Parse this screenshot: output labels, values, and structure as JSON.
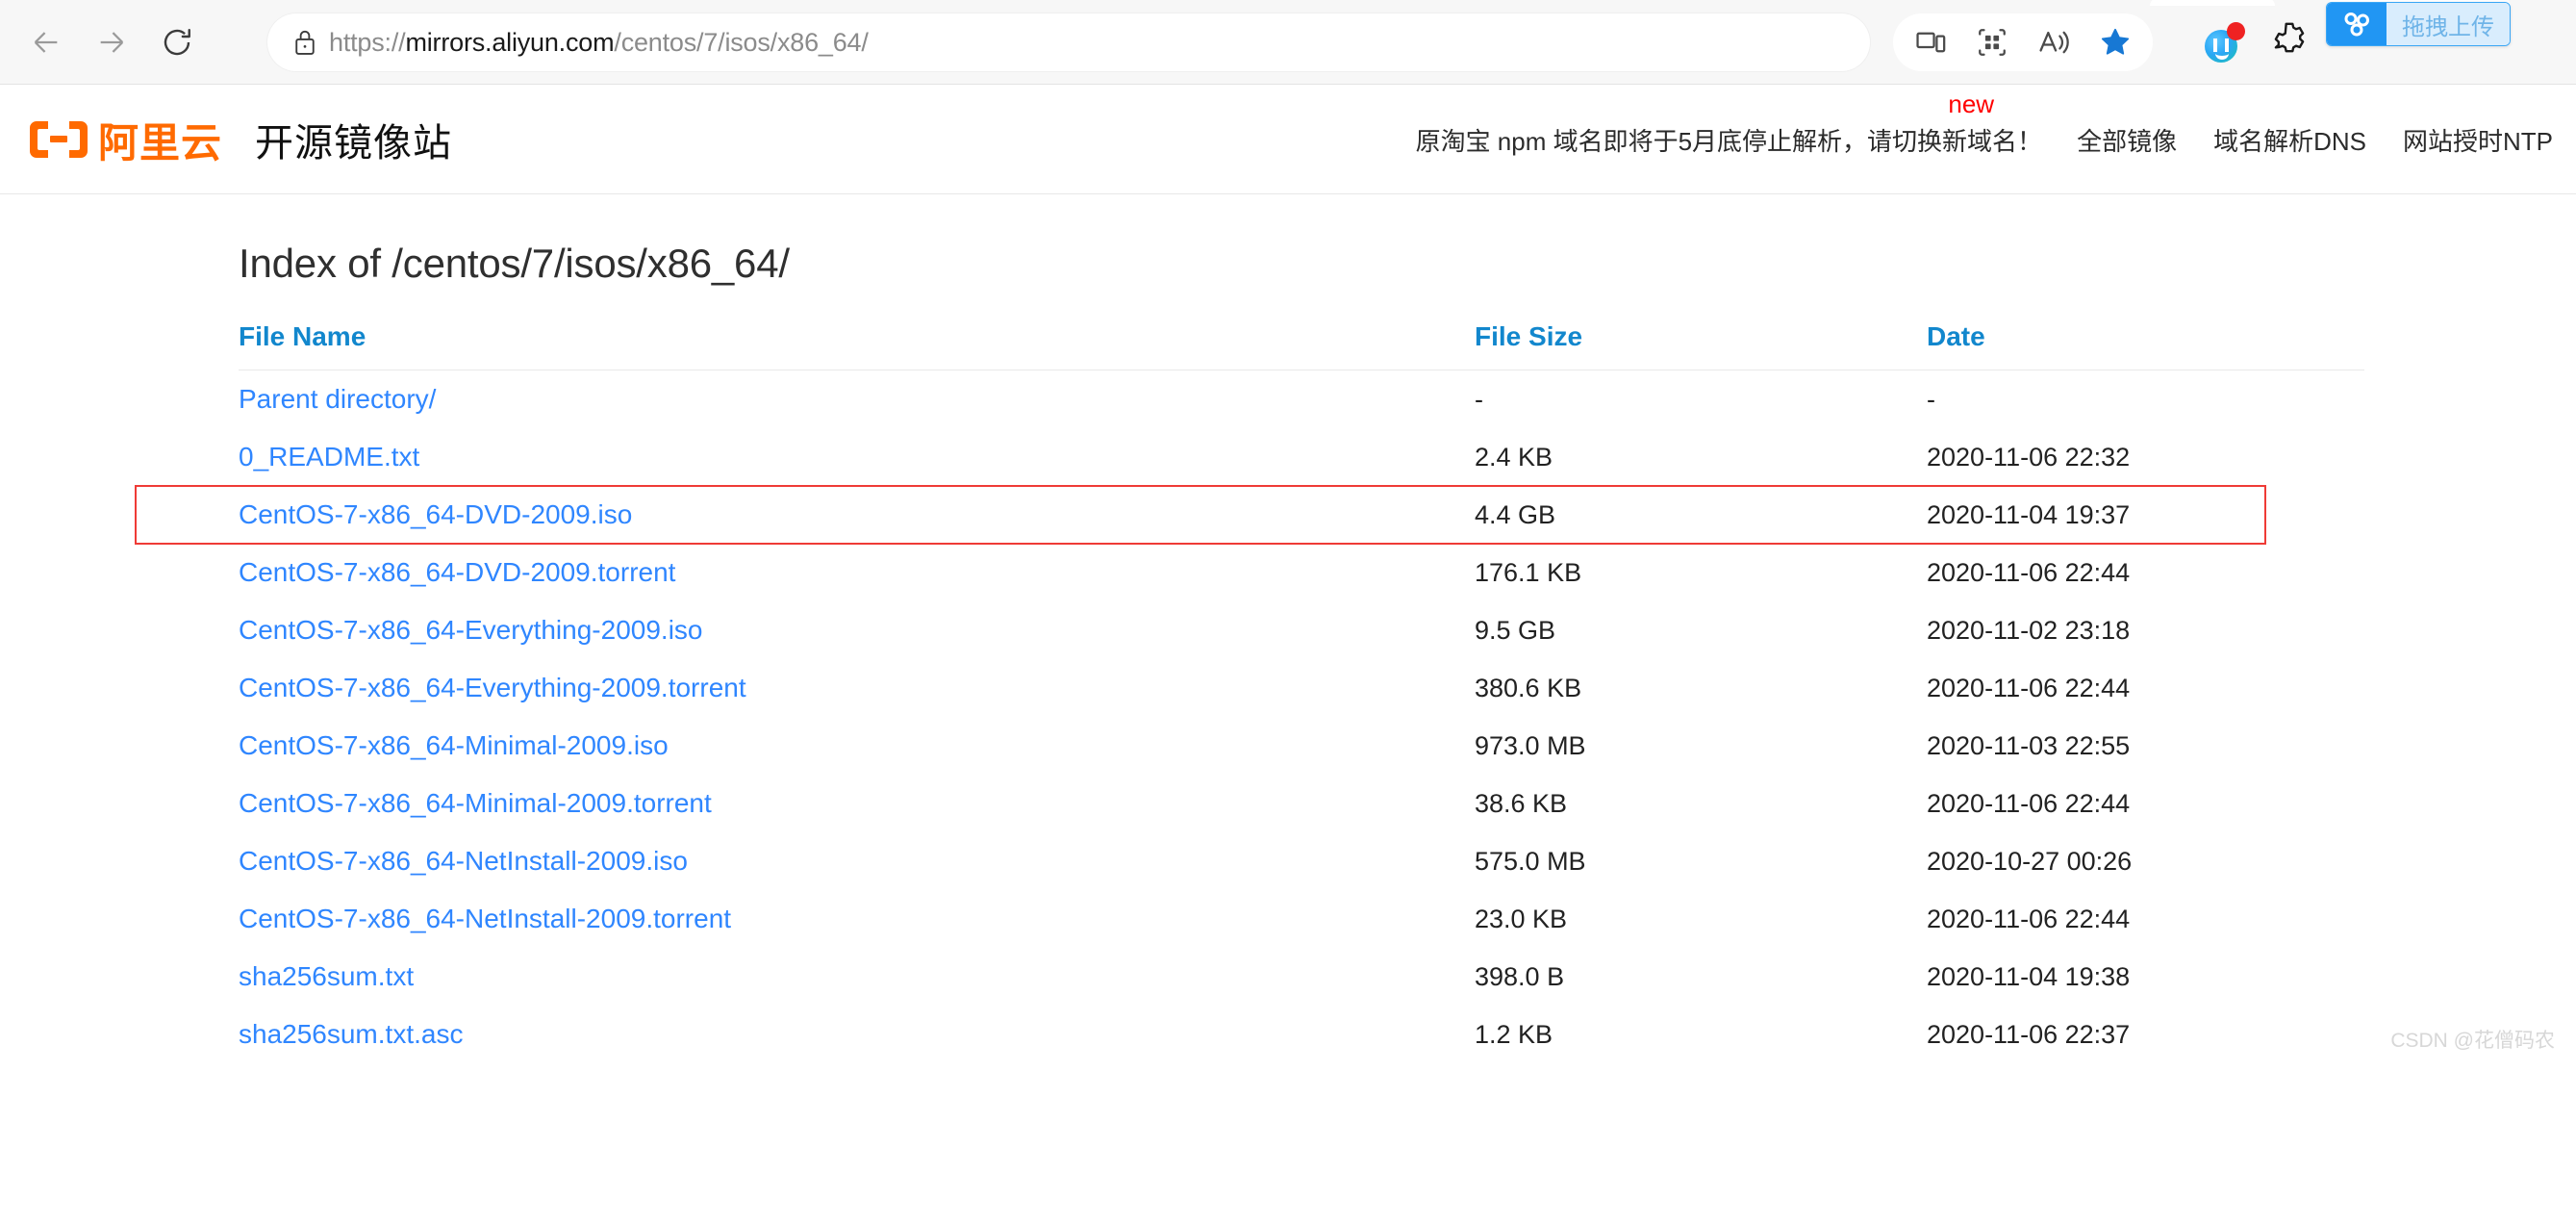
{
  "browser": {
    "back_tooltip": "Back",
    "forward_tooltip": "Forward",
    "refresh_tooltip": "Refresh",
    "url_scheme": "https://",
    "url_host": "mirrors.aliyun.com",
    "url_path": "/centos/7/isos/x86_64/",
    "url_full": "https://mirrors.aliyun.com/centos/7/isos/x86_64/",
    "toolbar_icons": [
      {
        "name": "cast-device-icon",
        "label": ""
      },
      {
        "name": "app-grid-icon",
        "label": ""
      },
      {
        "name": "read-aloud-icon",
        "label": ""
      },
      {
        "name": "favorites-star-icon",
        "label": ""
      }
    ],
    "extension_icons": [
      {
        "name": "baidu-netdisk-icon",
        "label": ""
      },
      {
        "name": "gear-extension-icon",
        "label": ""
      }
    ],
    "drag_upload": {
      "icon": "baidu-cloud-icon",
      "label": "拖拽上传"
    }
  },
  "site_header": {
    "logo_text": "阿里云",
    "site_name": "开源镜像站",
    "notice": "原淘宝 npm 域名即将于5月底停止解析，请切换新域名！",
    "notice_badge": "new",
    "nav": [
      {
        "label": "全部镜像"
      },
      {
        "label": "域名解析DNS"
      },
      {
        "label": "网站授时NTP"
      }
    ]
  },
  "main": {
    "index_title": "Index of /centos/7/isos/x86_64/",
    "columns": {
      "name": "File Name",
      "size": "File Size",
      "date": "Date"
    },
    "rows": [
      {
        "name": "Parent directory/",
        "size": "-",
        "date": "-"
      },
      {
        "name": "0_README.txt",
        "size": "2.4 KB",
        "date": "2020-11-06 22:32"
      },
      {
        "name": "CentOS-7-x86_64-DVD-2009.iso",
        "size": "4.4 GB",
        "date": "2020-11-04 19:37"
      },
      {
        "name": "CentOS-7-x86_64-DVD-2009.torrent",
        "size": "176.1 KB",
        "date": "2020-11-06 22:44"
      },
      {
        "name": "CentOS-7-x86_64-Everything-2009.iso",
        "size": "9.5 GB",
        "date": "2020-11-02 23:18"
      },
      {
        "name": "CentOS-7-x86_64-Everything-2009.torrent",
        "size": "380.6 KB",
        "date": "2020-11-06 22:44"
      },
      {
        "name": "CentOS-7-x86_64-Minimal-2009.iso",
        "size": "973.0 MB",
        "date": "2020-11-03 22:55"
      },
      {
        "name": "CentOS-7-x86_64-Minimal-2009.torrent",
        "size": "38.6 KB",
        "date": "2020-11-06 22:44"
      },
      {
        "name": "CentOS-7-x86_64-NetInstall-2009.iso",
        "size": "575.0 MB",
        "date": "2020-10-27 00:26"
      },
      {
        "name": "CentOS-7-x86_64-NetInstall-2009.torrent",
        "size": "23.0 KB",
        "date": "2020-11-06 22:44"
      },
      {
        "name": "sha256sum.txt",
        "size": "398.0 B",
        "date": "2020-11-04 19:38"
      },
      {
        "name": "sha256sum.txt.asc",
        "size": "1.2 KB",
        "date": "2020-11-06 22:37"
      }
    ],
    "highlighted_row_index": 2
  },
  "watermark": "CSDN @花僧码农",
  "colors": {
    "link_blue": "#2f86ff",
    "header_blue": "#1287cd",
    "brand_orange": "#ff6a00",
    "highlight_red": "#ef3b36",
    "badge_red": "#ff0000",
    "accent_blue": "#2196f3"
  }
}
